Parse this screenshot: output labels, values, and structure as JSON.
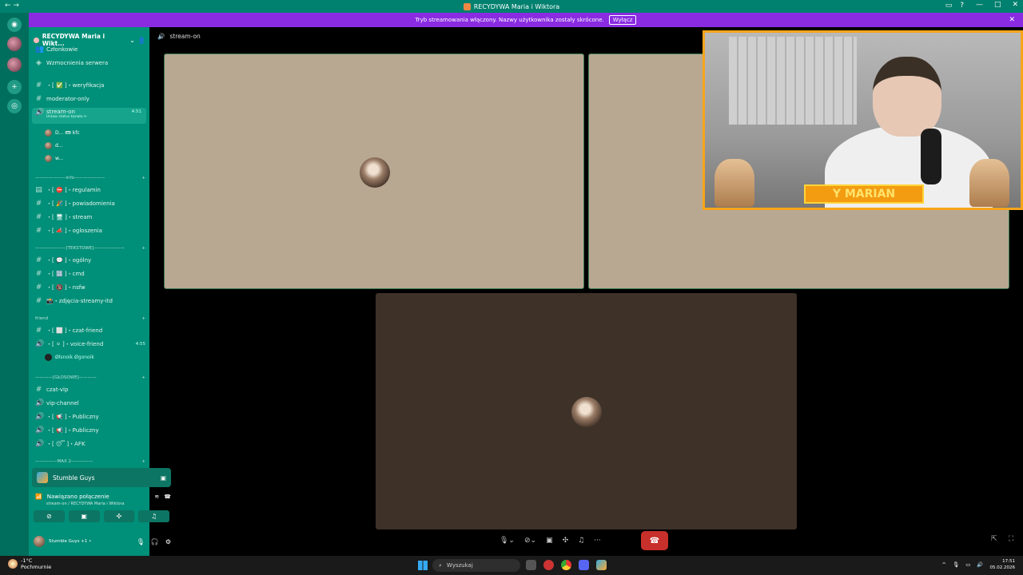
{
  "titlebar": {
    "title": "RECYDYWA Maria i Wiktora"
  },
  "banner": {
    "text": "Tryb streamowania włączony. Nazwy użytkownika zostały skrócone.",
    "button": "Wyłącz"
  },
  "server": {
    "name": "RECYDYWA Maria i Wikt...",
    "members_label": "Członkowie",
    "boosts_label": "Wzmocnienia serwera"
  },
  "channels": {
    "weryfikacja": "・[ ✅ ]・weryfikacja",
    "moderator": "moderator-only",
    "stream_on": "stream-on",
    "stream_status": "Ustaw status kanału ✏",
    "stream_time": "4:51",
    "stream_users": [
      "D... 🎟 kfc",
      "d...",
      "w..."
    ],
    "cat_info": "———————info———————",
    "regulamin": "・[ ⛔ ]・regulamin",
    "powiadomienia": "・[ 🎉 ]・powiadomienia",
    "stream": "・[ 🖥 ]・stream",
    "ogloszenia": "・[ 📣 ]・ogloszenia",
    "cat_tekstowe": "———————[TEKSTOWE]———————",
    "ogolny": "・[ 💬 ]・ogólny",
    "cmd": "・[ 🔢 ]・cmd",
    "nsfw": "・[ 🔞 ]・nsfw",
    "zdjecia": "📸・zdjęcia-streamy-itd",
    "cat_friend": "friend",
    "czat_friend": "・[ ⬜ ]・czat-friend",
    "voice_friend": "・[ ⚪ ]・voice-friend",
    "voice_time": "4:55",
    "voice_user": "Ølsnoik Øgonoik",
    "cat_glosowe": "————[GŁOSOWE]————",
    "czat_vip": "czat-vip",
    "vip_channel": "vip-channel",
    "publiczny1": "・[ 📢 ]・Publiczny",
    "publiczny2": "・[ 📢 ]・Publiczny",
    "afk": "・[ 😴 ]・AFK",
    "cat_max": "—————MAX 2—————"
  },
  "activity": {
    "game": "Stumble Guys"
  },
  "connection": {
    "status": "Nawiązano połączenie",
    "sub": "stream-on / RECYDYWA Maria i Wiktora"
  },
  "user": {
    "status": "Stumble Guys +1 •"
  },
  "topbar": {
    "channel": "stream-on"
  },
  "overlay": {
    "label": "Y MARIAN"
  },
  "taskbar": {
    "temp": "-1°C",
    "weather": "Pochmurnie",
    "search": "Wyszukaj",
    "time": "17:51",
    "date": "05.02.2026"
  },
  "colors": {
    "accent": "#008f78",
    "banner": "#8a2be2",
    "end_call": "#c8302b",
    "tile1": "#b8a892",
    "tile2": "#b8a892",
    "tile3": "#3d3128"
  }
}
